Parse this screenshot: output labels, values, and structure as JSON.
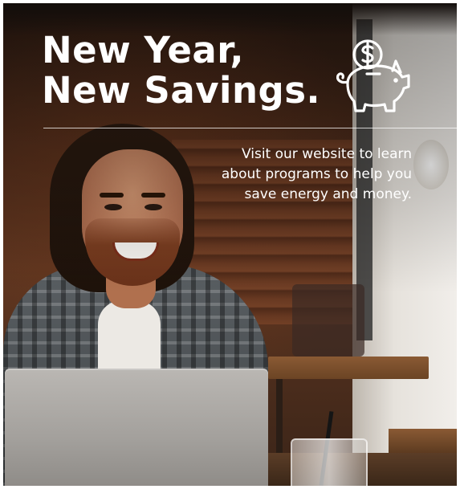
{
  "ad": {
    "headline": [
      "New Year,",
      "New Savings."
    ],
    "tagline": [
      "Visit our website to learn",
      "about programs to help you",
      "save energy and money."
    ],
    "icon": "piggy-bank-dollar-icon",
    "colors": {
      "text": "#ffffff",
      "icon_stroke": "#ffffff"
    }
  }
}
